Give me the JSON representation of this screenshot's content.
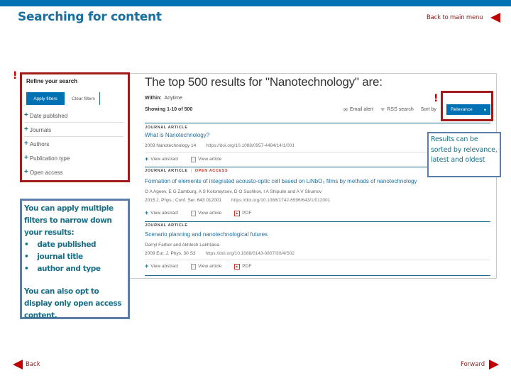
{
  "slide": {
    "title": "Searching for content",
    "back_to_main_label": "Back to main menu",
    "footer": {
      "back_label": "Back",
      "forward_label": "Forward"
    },
    "colors": {
      "brand_blue": "#0071b3",
      "title_teal": "#1a6f9e",
      "highlight_red": "#a31a1a",
      "nav_red": "#c00000",
      "callout_border": "#5b7ea8"
    },
    "alert_marks": [
      "!",
      "!"
    ]
  },
  "filters": {
    "heading": "Refine your search",
    "apply_label": "Apply filters",
    "clear_label": "Clear filters",
    "items": [
      {
        "label": "Date published",
        "icon": "plus-icon"
      },
      {
        "label": "Journals",
        "icon": "plus-icon"
      },
      {
        "label": "Authors",
        "icon": "plus-icon"
      },
      {
        "label": "Publication type",
        "icon": "plus-icon"
      },
      {
        "label": "Open access",
        "icon": "plus-icon"
      }
    ]
  },
  "results": {
    "heading": "The top 500 results for \"Nanotechnology\" are:",
    "within_label": "Within:",
    "within_value": "Anytime",
    "showing": "Showing 1-10 of 500",
    "email_alert": "Email alert",
    "rss_search": "RSS search",
    "sort_label": "Sort by",
    "sort_value": "Relevance",
    "items": [
      {
        "type": "JOURNAL ARTICLE",
        "open_access": "",
        "title": "What is Nanotechnology?",
        "authors": "",
        "citation": "2003 Nanotechnology 14",
        "doi": "https://doi.org/10.1088/0957-4484/14/1/001",
        "actions": [
          "View abstract",
          "View article"
        ]
      },
      {
        "type": "JOURNAL ARTICLE",
        "open_access": "OPEN ACCESS",
        "title": "Formation of elements of integrated acousto-optic cell based on LiNbO₃ films by methods of nanotechnology",
        "authors": "O A Ageev, E G Zamburg, A S Kolomiytsev, D O Sushkov, I A Shipulin and A V Shumov",
        "citation": "2015 J. Phys.: Conf. Ser. 643 012001",
        "doi": "https://doi.org/10.1088/1742-6596/643/1/012001",
        "actions": [
          "View abstract",
          "View article",
          "PDF"
        ]
      },
      {
        "type": "JOURNAL ARTICLE",
        "open_access": "",
        "title": "Scenario planning and nanotechnological futures",
        "authors": "Darryl Farber and Akhlesh Lakhtakia",
        "citation": "2009 Eur. J. Phys. 30 S3",
        "doi": "https://doi.org/10.1088/0143-0807/30/4/S02",
        "actions": [
          "View abstract",
          "View article",
          "PDF"
        ]
      }
    ]
  },
  "callouts": {
    "sort_note": "Results can be sorted by relevance, latest and oldest",
    "filter_intro": "You can apply multiple filters to narrow down your results:",
    "filter_bullets": [
      "date published",
      "journal title",
      "author and type"
    ],
    "filter_outro": "You can also opt to display only open access content."
  }
}
